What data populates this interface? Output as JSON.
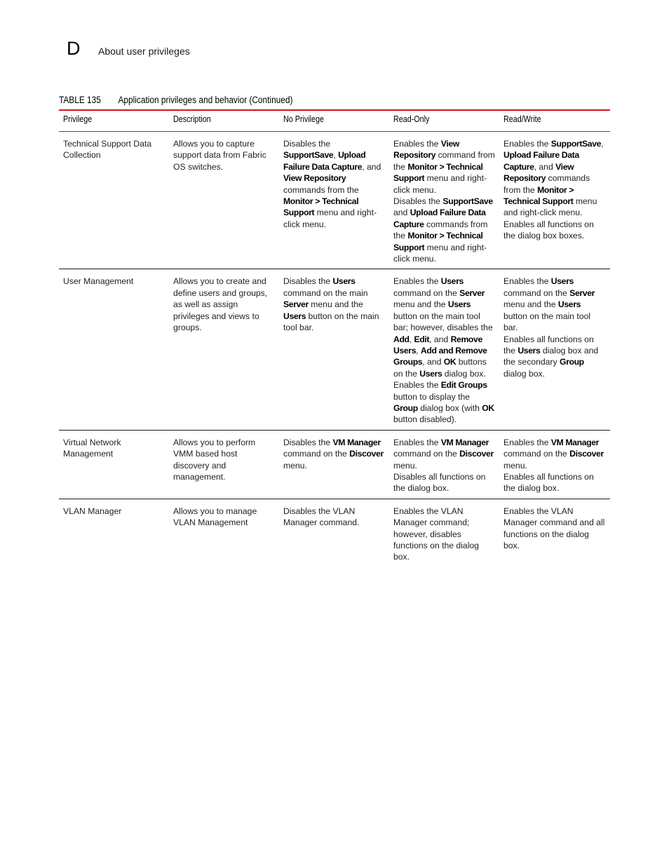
{
  "header": {
    "chapter_letter": "D",
    "section_title": "About user privileges"
  },
  "table": {
    "number_label": "TABLE 135",
    "title": "Application privileges and behavior (Continued)",
    "accent_color": "#d9121f",
    "columns": [
      "Privilege",
      "Description",
      "No Privilege",
      "Read-Only",
      "Read/Write"
    ],
    "rows": [
      {
        "privilege": "Technical Support Data Collection",
        "description": "Allows you to capture support data from Fabric OS switches.",
        "no_privilege": [
          [
            {
              "t": "Disables the "
            },
            {
              "t": "SupportSave",
              "b": true
            },
            {
              "t": ", "
            },
            {
              "t": "Upload Failure Data Capture",
              "b": true
            },
            {
              "t": ", and "
            },
            {
              "t": "View Repository",
              "b": true
            },
            {
              "t": " commands from the "
            },
            {
              "t": "Monitor > Technical Support",
              "b": true
            },
            {
              "t": " menu and right-click menu."
            }
          ]
        ],
        "read_only": [
          [
            {
              "t": "Enables the "
            },
            {
              "t": "View Repository",
              "b": true
            },
            {
              "t": " command from the "
            },
            {
              "t": "Monitor > Technical Support",
              "b": true
            },
            {
              "t": " menu and right-click menu."
            }
          ],
          [
            {
              "t": "Disables the "
            },
            {
              "t": "SupportSave",
              "b": true
            },
            {
              "t": " and "
            },
            {
              "t": "Upload Failure Data Capture",
              "b": true
            },
            {
              "t": " commands from the "
            },
            {
              "t": "Monitor > Technical Support",
              "b": true
            },
            {
              "t": " menu and right-click menu."
            }
          ]
        ],
        "read_write": [
          [
            {
              "t": "Enables the "
            },
            {
              "t": "SupportSave",
              "b": true
            },
            {
              "t": ", "
            },
            {
              "t": "Upload Failure Data Capture",
              "b": true
            },
            {
              "t": ", and "
            },
            {
              "t": "View Repository",
              "b": true
            },
            {
              "t": " commands from the "
            },
            {
              "t": "Monitor > Technical Support",
              "b": true
            },
            {
              "t": " menu and right-click menu."
            }
          ],
          [
            {
              "t": "Enables all functions on the dialog box boxes."
            }
          ]
        ]
      },
      {
        "privilege": "User Management",
        "description": "Allows you to create and define users and groups, as well as assign privileges and views to groups.",
        "no_privilege": [
          [
            {
              "t": "Disables the "
            },
            {
              "t": "Users",
              "b": true
            },
            {
              "t": " command on the main "
            },
            {
              "t": "Server",
              "b": true
            },
            {
              "t": " menu and the "
            },
            {
              "t": "Users",
              "b": true
            },
            {
              "t": " button on the main tool bar."
            }
          ]
        ],
        "read_only": [
          [
            {
              "t": "Enables the "
            },
            {
              "t": "Users",
              "b": true
            },
            {
              "t": " command on the "
            },
            {
              "t": "Server",
              "b": true
            },
            {
              "t": " menu and the "
            },
            {
              "t": "Users",
              "b": true
            },
            {
              "t": " button on the main tool bar; however, disables the "
            },
            {
              "t": "Add",
              "b": true
            },
            {
              "t": ", "
            },
            {
              "t": "Edit",
              "b": true
            },
            {
              "t": ", and "
            },
            {
              "t": "Remove Users",
              "b": true
            },
            {
              "t": ", "
            },
            {
              "t": "Add and Remove Groups",
              "b": true
            },
            {
              "t": ", and "
            },
            {
              "t": "OK",
              "b": true
            },
            {
              "t": " buttons on the "
            },
            {
              "t": "Users",
              "b": true
            },
            {
              "t": " dialog box."
            }
          ],
          [
            {
              "t": "Enables the "
            },
            {
              "t": "Edit Groups",
              "b": true
            },
            {
              "t": " button to display the "
            },
            {
              "t": "Group",
              "b": true
            },
            {
              "t": " dialog box (with "
            },
            {
              "t": "OK",
              "b": true
            },
            {
              "t": " button disabled)."
            }
          ]
        ],
        "read_write": [
          [
            {
              "t": "Enables the "
            },
            {
              "t": "Users",
              "b": true
            },
            {
              "t": " command on the "
            },
            {
              "t": "Server",
              "b": true
            },
            {
              "t": " menu and the "
            },
            {
              "t": "Users",
              "b": true
            },
            {
              "t": " button on the main tool bar."
            }
          ],
          [
            {
              "t": "Enables all functions on the "
            },
            {
              "t": "Users",
              "b": true
            },
            {
              "t": " dialog box and the secondary "
            },
            {
              "t": "Group",
              "b": true
            },
            {
              "t": " dialog box."
            }
          ]
        ]
      },
      {
        "privilege": "Virtual Network Management",
        "description": "Allows you to perform VMM based host discovery and management.",
        "no_privilege": [
          [
            {
              "t": "Disables the "
            },
            {
              "t": "VM Manager",
              "b": true
            },
            {
              "t": " command on the "
            },
            {
              "t": "Discover",
              "b": true
            },
            {
              "t": " menu."
            }
          ]
        ],
        "read_only": [
          [
            {
              "t": "Enables the "
            },
            {
              "t": "VM Manager",
              "b": true
            },
            {
              "t": " command on the "
            },
            {
              "t": "Discover",
              "b": true
            },
            {
              "t": " menu."
            }
          ],
          [
            {
              "t": "Disables all functions on the dialog box."
            }
          ]
        ],
        "read_write": [
          [
            {
              "t": "Enables the "
            },
            {
              "t": "VM Manager",
              "b": true
            },
            {
              "t": " command on the "
            },
            {
              "t": "Discover",
              "b": true
            },
            {
              "t": " menu."
            }
          ],
          [
            {
              "t": "Enables all functions on the dialog box."
            }
          ]
        ]
      },
      {
        "privilege": "VLAN Manager",
        "description": "Allows you to manage VLAN Management",
        "no_privilege": [
          [
            {
              "t": "Disables the VLAN Manager command."
            }
          ]
        ],
        "read_only": [
          [
            {
              "t": "Enables the VLAN Manager command; however, disables functions on the dialog box."
            }
          ]
        ],
        "read_write": [
          [
            {
              "t": "Enables the VLAN Manager command and all functions on the dialog box."
            }
          ]
        ]
      }
    ]
  }
}
